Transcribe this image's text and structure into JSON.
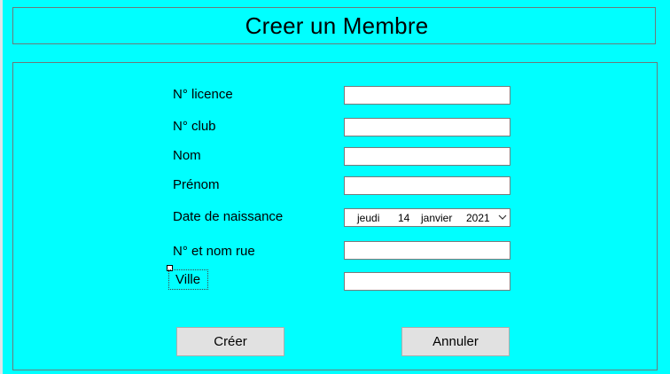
{
  "header": {
    "title": "Creer un Membre"
  },
  "form": {
    "fields": [
      {
        "label": "N° licence",
        "value": ""
      },
      {
        "label": "N° club",
        "value": ""
      },
      {
        "label": "Nom",
        "value": ""
      },
      {
        "label": "Prénom",
        "value": ""
      },
      {
        "label": "Date de naissance",
        "value": ""
      },
      {
        "label": "N° et nom rue",
        "value": ""
      },
      {
        "label": "Ville",
        "value": ""
      }
    ],
    "date": {
      "weekday": "jeudi",
      "day": "14",
      "month": "janvier",
      "year": "2021"
    }
  },
  "buttons": {
    "create": "Créer",
    "cancel": "Annuler"
  },
  "colors": {
    "background": "#00ffff",
    "border": "#6c7a7a",
    "button": "#e1e1e1"
  }
}
